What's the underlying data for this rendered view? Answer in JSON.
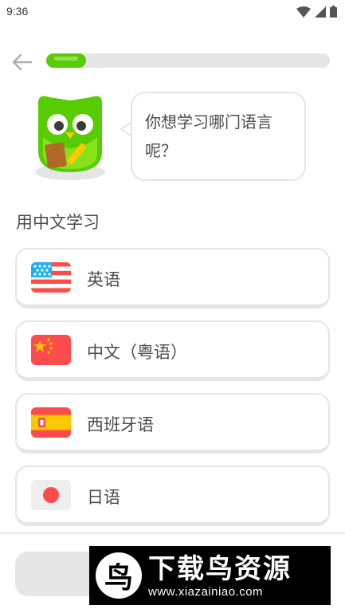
{
  "status_bar": {
    "time": "9:36"
  },
  "progress": {
    "fraction": 0.14,
    "color": "#58cc02"
  },
  "bubble": {
    "text": "你想学习哪门语言呢？"
  },
  "section": {
    "label": "用中文学习"
  },
  "languages": [
    {
      "label": "英语",
      "flag": "us-flag-icon"
    },
    {
      "label": "中文（粤语）",
      "flag": "china-flag-icon"
    },
    {
      "label": "西班牙语",
      "flag": "spain-flag-icon"
    },
    {
      "label": "日语",
      "flag": "japan-flag-icon"
    }
  ],
  "watermark": {
    "title": "下载鸟资源",
    "url": "www.xiazainiao.com",
    "logo_char": "鸟"
  },
  "colors": {
    "accent": "#58cc02",
    "border": "#e5e5e5",
    "text": "#4b4b4b"
  }
}
